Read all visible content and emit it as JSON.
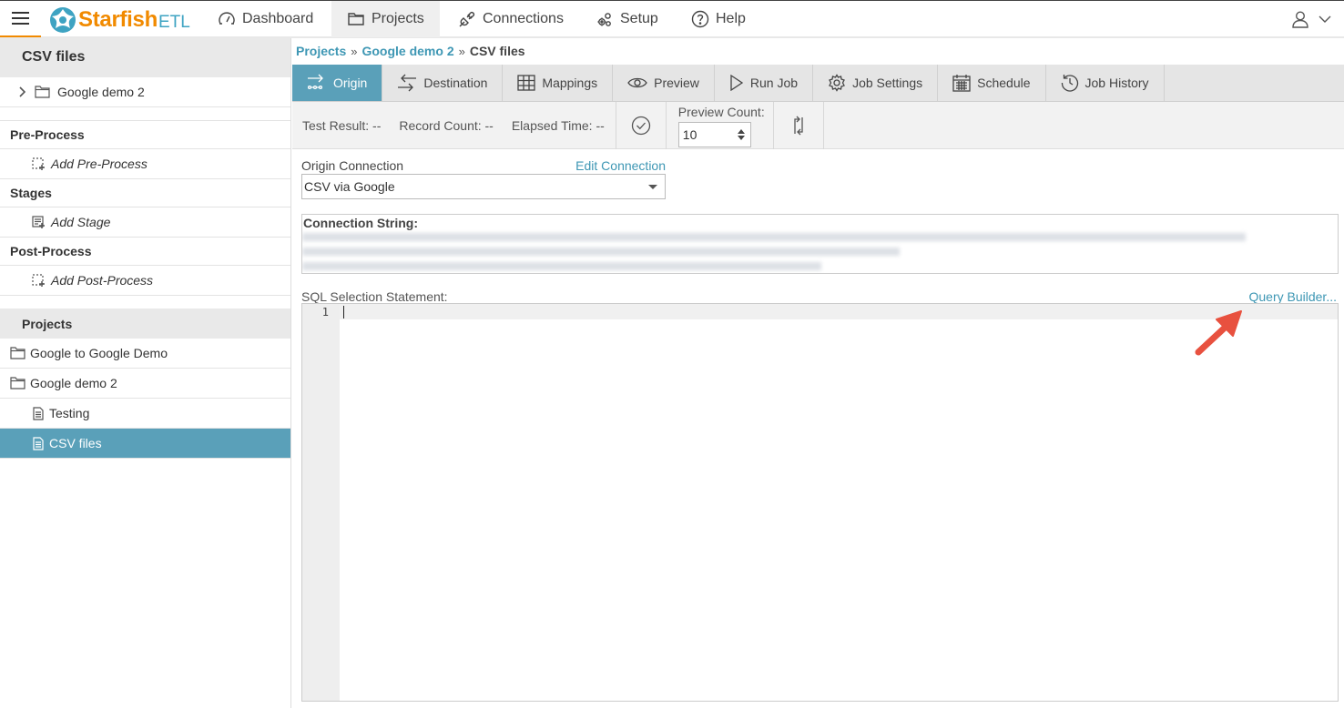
{
  "topbar": {
    "brand": "Starfish",
    "brand_suffix": "ETL",
    "nav": [
      {
        "label": "Dashboard",
        "icon": "gauge-icon"
      },
      {
        "label": "Projects",
        "icon": "folder-icon"
      },
      {
        "label": "Connections",
        "icon": "plug-icon"
      },
      {
        "label": "Setup",
        "icon": "gears-icon"
      },
      {
        "label": "Help",
        "icon": "help-icon"
      }
    ]
  },
  "sidebar": {
    "title": "CSV files",
    "tree_item": "Google demo 2",
    "sections": [
      {
        "title": "Pre-Process",
        "add": "Add Pre-Process"
      },
      {
        "title": "Stages",
        "add": "Add Stage"
      },
      {
        "title": "Post-Process",
        "add": "Add Post-Process"
      }
    ],
    "projects_title": "Projects",
    "projects": [
      {
        "label": "Google to Google Demo",
        "type": "folder"
      },
      {
        "label": "Google demo 2",
        "type": "folder"
      },
      {
        "label": "Testing",
        "type": "job"
      },
      {
        "label": "CSV files",
        "type": "job",
        "selected": true
      }
    ]
  },
  "breadcrumb": {
    "items": [
      "Projects",
      "Google demo 2",
      "CSV files"
    ],
    "separator": "»"
  },
  "tabs": [
    {
      "label": "Origin",
      "active": true
    },
    {
      "label": "Destination"
    },
    {
      "label": "Mappings"
    },
    {
      "label": "Preview"
    },
    {
      "label": "Run Job"
    },
    {
      "label": "Job Settings"
    },
    {
      "label": "Schedule"
    },
    {
      "label": "Job History"
    }
  ],
  "toolbar": {
    "test_result": "Test Result: --",
    "record_count": "Record Count: --",
    "elapsed_time": "Elapsed Time: --",
    "preview_count_label": "Preview Count:",
    "preview_count_value": "10"
  },
  "origin": {
    "connection_label": "Origin Connection",
    "edit_connection": "Edit Connection",
    "connection_value": "CSV via Google",
    "connection_string_label": "Connection String:",
    "sql_label": "SQL Selection Statement:",
    "query_builder": "Query Builder...",
    "line_number": "1"
  },
  "colors": {
    "accent": "#5aa0b9",
    "link": "#3e97b4",
    "brand_orange": "#f18a00",
    "annotation_arrow": "#e8513f"
  }
}
